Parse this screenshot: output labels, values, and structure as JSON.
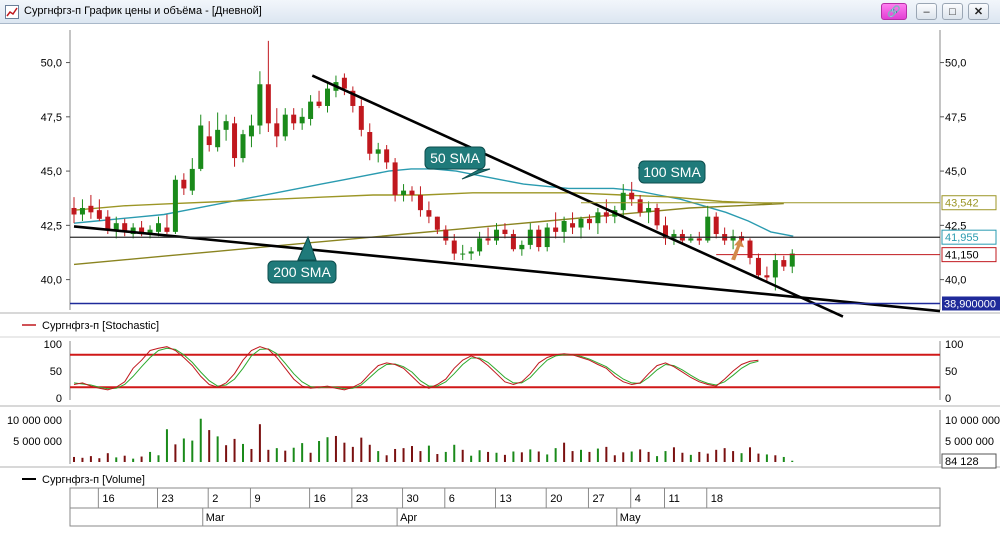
{
  "window": {
    "title": "Сургнфгз-п График цены и объёма - [Дневной]",
    "buttons": [
      "link",
      "minimize",
      "restore",
      "close"
    ]
  },
  "legend": {
    "stochastic": "Сургнфгз-п [Stochastic]",
    "volume": "Сургнфгз-п [Volume]"
  },
  "colors": {
    "up": "#1a8a1a",
    "down": "#c0181e",
    "sma50": "#2a9bb0",
    "sma100": "#9c9626",
    "sma200": "#8a8420",
    "callout": "#1f7a7a",
    "stoch_k": "#c0181e",
    "stoch_d": "#2eaa2e",
    "blue_line": "#1f2a9a"
  },
  "chart_data": {
    "type": "candlestick",
    "price_axis": {
      "ticks": [
        "50,0",
        "47,5",
        "45,0",
        "42,5",
        "40,0"
      ],
      "tick_values": [
        50,
        47.5,
        45,
        42.5,
        40
      ],
      "ylim": [
        38.6,
        51.5
      ]
    },
    "price_markers": [
      {
        "label": "43,542",
        "value": 43.542,
        "color": "#9c9626"
      },
      {
        "label": "41,955",
        "value": 41.955,
        "color": "#2a9bb0"
      },
      {
        "label": "41,150",
        "value": 41.15,
        "color": "#c0181e"
      },
      {
        "label": "38,900000",
        "value": 38.9,
        "color": "#1f2a9a"
      }
    ],
    "annotations": [
      {
        "text": "50 SMA"
      },
      {
        "text": "100 SMA"
      },
      {
        "text": "200 SMA"
      }
    ],
    "candles": [
      {
        "o": 43.3,
        "h": 43.8,
        "l": 42.6,
        "c": 43.0
      },
      {
        "o": 43.0,
        "h": 43.7,
        "l": 42.7,
        "c": 43.3
      },
      {
        "o": 43.4,
        "h": 43.9,
        "l": 42.8,
        "c": 43.1
      },
      {
        "o": 43.2,
        "h": 43.7,
        "l": 42.7,
        "c": 42.8
      },
      {
        "o": 42.9,
        "h": 43.2,
        "l": 42.1,
        "c": 42.3
      },
      {
        "o": 42.3,
        "h": 42.9,
        "l": 41.9,
        "c": 42.6
      },
      {
        "o": 42.6,
        "h": 42.8,
        "l": 42.0,
        "c": 42.2
      },
      {
        "o": 42.1,
        "h": 42.6,
        "l": 41.9,
        "c": 42.4
      },
      {
        "o": 42.4,
        "h": 42.7,
        "l": 42.0,
        "c": 42.1
      },
      {
        "o": 42.1,
        "h": 42.5,
        "l": 41.9,
        "c": 42.3
      },
      {
        "o": 42.2,
        "h": 42.9,
        "l": 42.0,
        "c": 42.6
      },
      {
        "o": 42.4,
        "h": 43.0,
        "l": 42.1,
        "c": 42.2
      },
      {
        "o": 42.2,
        "h": 44.8,
        "l": 42.1,
        "c": 44.6
      },
      {
        "o": 44.6,
        "h": 44.9,
        "l": 43.9,
        "c": 44.2
      },
      {
        "o": 44.1,
        "h": 45.6,
        "l": 43.9,
        "c": 45.1
      },
      {
        "o": 45.1,
        "h": 47.6,
        "l": 45.0,
        "c": 47.1
      },
      {
        "o": 46.6,
        "h": 47.3,
        "l": 45.9,
        "c": 46.2
      },
      {
        "o": 46.1,
        "h": 47.7,
        "l": 45.9,
        "c": 46.9
      },
      {
        "o": 46.9,
        "h": 47.6,
        "l": 46.4,
        "c": 47.3
      },
      {
        "o": 47.2,
        "h": 47.5,
        "l": 45.2,
        "c": 45.6
      },
      {
        "o": 45.6,
        "h": 46.9,
        "l": 45.4,
        "c": 46.7
      },
      {
        "o": 46.6,
        "h": 47.6,
        "l": 46.1,
        "c": 47.1
      },
      {
        "o": 47.1,
        "h": 49.6,
        "l": 46.7,
        "c": 49.0
      },
      {
        "o": 49.0,
        "h": 51.0,
        "l": 46.8,
        "c": 47.2
      },
      {
        "o": 47.2,
        "h": 47.9,
        "l": 46.1,
        "c": 46.6
      },
      {
        "o": 46.6,
        "h": 47.9,
        "l": 46.4,
        "c": 47.6
      },
      {
        "o": 47.6,
        "h": 47.9,
        "l": 46.9,
        "c": 47.2
      },
      {
        "o": 47.2,
        "h": 47.9,
        "l": 46.9,
        "c": 47.5
      },
      {
        "o": 47.4,
        "h": 48.5,
        "l": 47.1,
        "c": 48.2
      },
      {
        "o": 48.2,
        "h": 48.7,
        "l": 47.9,
        "c": 48.0
      },
      {
        "o": 48.0,
        "h": 49.1,
        "l": 47.7,
        "c": 48.8
      },
      {
        "o": 48.7,
        "h": 49.4,
        "l": 48.4,
        "c": 49.1
      },
      {
        "o": 49.3,
        "h": 49.5,
        "l": 48.5,
        "c": 48.8
      },
      {
        "o": 48.7,
        "h": 48.9,
        "l": 47.7,
        "c": 48.0
      },
      {
        "o": 48.0,
        "h": 48.3,
        "l": 46.6,
        "c": 46.9
      },
      {
        "o": 46.8,
        "h": 47.2,
        "l": 45.5,
        "c": 45.8
      },
      {
        "o": 45.8,
        "h": 46.3,
        "l": 45.4,
        "c": 46.0
      },
      {
        "o": 46.0,
        "h": 46.2,
        "l": 45.1,
        "c": 45.4
      },
      {
        "o": 45.4,
        "h": 45.6,
        "l": 43.6,
        "c": 43.9
      },
      {
        "o": 43.9,
        "h": 44.4,
        "l": 43.6,
        "c": 44.1
      },
      {
        "o": 44.1,
        "h": 44.3,
        "l": 43.6,
        "c": 43.9
      },
      {
        "o": 43.9,
        "h": 44.3,
        "l": 42.9,
        "c": 43.2
      },
      {
        "o": 43.2,
        "h": 43.6,
        "l": 42.6,
        "c": 42.9
      },
      {
        "o": 42.9,
        "h": 42.9,
        "l": 42.1,
        "c": 42.3
      },
      {
        "o": 42.3,
        "h": 42.5,
        "l": 41.6,
        "c": 41.8
      },
      {
        "o": 41.8,
        "h": 42.1,
        "l": 40.9,
        "c": 41.2
      },
      {
        "o": 41.2,
        "h": 41.6,
        "l": 40.9,
        "c": 41.2
      },
      {
        "o": 41.2,
        "h": 41.5,
        "l": 40.9,
        "c": 41.3
      },
      {
        "o": 41.3,
        "h": 42.2,
        "l": 41.1,
        "c": 41.9
      },
      {
        "o": 41.9,
        "h": 42.4,
        "l": 41.6,
        "c": 41.8
      },
      {
        "o": 41.8,
        "h": 42.6,
        "l": 41.6,
        "c": 42.3
      },
      {
        "o": 42.3,
        "h": 42.6,
        "l": 41.9,
        "c": 42.1
      },
      {
        "o": 42.1,
        "h": 42.3,
        "l": 41.3,
        "c": 41.4
      },
      {
        "o": 41.4,
        "h": 41.8,
        "l": 41.1,
        "c": 41.6
      },
      {
        "o": 41.6,
        "h": 42.6,
        "l": 41.4,
        "c": 42.3
      },
      {
        "o": 42.3,
        "h": 42.5,
        "l": 41.3,
        "c": 41.5
      },
      {
        "o": 41.5,
        "h": 42.6,
        "l": 41.3,
        "c": 42.4
      },
      {
        "o": 42.4,
        "h": 43.1,
        "l": 41.9,
        "c": 42.2
      },
      {
        "o": 42.2,
        "h": 42.9,
        "l": 41.7,
        "c": 42.7
      },
      {
        "o": 42.6,
        "h": 43.1,
        "l": 42.1,
        "c": 42.4
      },
      {
        "o": 42.4,
        "h": 42.9,
        "l": 41.9,
        "c": 42.8
      },
      {
        "o": 42.8,
        "h": 43.0,
        "l": 42.3,
        "c": 42.6
      },
      {
        "o": 42.6,
        "h": 43.3,
        "l": 42.1,
        "c": 43.1
      },
      {
        "o": 43.1,
        "h": 43.7,
        "l": 42.6,
        "c": 42.9
      },
      {
        "o": 42.9,
        "h": 43.4,
        "l": 42.6,
        "c": 43.2
      },
      {
        "o": 43.2,
        "h": 44.4,
        "l": 42.9,
        "c": 44.0
      },
      {
        "o": 44.0,
        "h": 44.5,
        "l": 43.4,
        "c": 43.7
      },
      {
        "o": 43.7,
        "h": 43.9,
        "l": 42.9,
        "c": 43.1
      },
      {
        "o": 43.1,
        "h": 43.6,
        "l": 42.6,
        "c": 43.3
      },
      {
        "o": 43.3,
        "h": 43.5,
        "l": 42.3,
        "c": 42.5
      },
      {
        "o": 42.5,
        "h": 42.9,
        "l": 41.6,
        "c": 41.9
      },
      {
        "o": 41.9,
        "h": 42.3,
        "l": 41.6,
        "c": 42.1
      },
      {
        "o": 42.1,
        "h": 42.3,
        "l": 41.6,
        "c": 41.8
      },
      {
        "o": 41.8,
        "h": 42.1,
        "l": 41.7,
        "c": 41.9
      },
      {
        "o": 41.9,
        "h": 42.2,
        "l": 41.6,
        "c": 41.8
      },
      {
        "o": 41.8,
        "h": 43.4,
        "l": 41.7,
        "c": 42.9
      },
      {
        "o": 42.9,
        "h": 43.1,
        "l": 41.9,
        "c": 42.1
      },
      {
        "o": 42.1,
        "h": 42.4,
        "l": 41.6,
        "c": 41.8
      },
      {
        "o": 41.8,
        "h": 42.3,
        "l": 41.4,
        "c": 42.0
      },
      {
        "o": 42.0,
        "h": 42.2,
        "l": 41.6,
        "c": 41.8
      },
      {
        "o": 41.8,
        "h": 41.9,
        "l": 40.7,
        "c": 41.0
      },
      {
        "o": 41.0,
        "h": 41.2,
        "l": 40.1,
        "c": 40.2
      },
      {
        "o": 40.2,
        "h": 40.6,
        "l": 39.9,
        "c": 40.1
      },
      {
        "o": 40.1,
        "h": 41.2,
        "l": 39.5,
        "c": 40.9
      },
      {
        "o": 40.9,
        "h": 41.1,
        "l": 40.4,
        "c": 40.6
      },
      {
        "o": 40.6,
        "h": 41.4,
        "l": 40.3,
        "c": 41.2
      }
    ],
    "sma50": [
      42.6,
      42.7,
      42.8,
      42.9,
      43.0,
      43.2,
      43.4,
      43.6,
      43.8,
      44.0,
      44.2,
      44.4,
      44.6,
      44.8,
      45.0,
      45.1,
      45.1,
      45.0,
      44.8,
      44.6,
      44.4,
      44.3,
      44.2,
      44.2,
      44.2,
      44.1,
      43.9,
      43.7,
      43.4,
      43.1,
      42.7,
      42.2,
      42.0
    ],
    "sma100": [
      43.2,
      43.4,
      43.5,
      43.6,
      43.7,
      43.8,
      43.9,
      43.9,
      44.0,
      44.0,
      44.0,
      43.9,
      43.8,
      43.6,
      43.5
    ],
    "sma200": [
      40.7,
      40.9,
      41.1,
      41.3,
      41.5,
      41.7,
      41.9,
      42.1,
      42.3,
      42.5,
      42.7,
      42.9,
      43.1,
      43.3,
      43.4,
      43.5
    ],
    "stochastic": {
      "ticks": [
        "100",
        "50",
        "0"
      ],
      "tick_values": [
        100,
        50,
        0
      ],
      "levels": [
        80,
        20
      ],
      "k": [
        25,
        28,
        22,
        18,
        15,
        20,
        30,
        55,
        70,
        88,
        92,
        95,
        88,
        75,
        60,
        40,
        25,
        20,
        28,
        45,
        70,
        88,
        95,
        90,
        75,
        55,
        35,
        22,
        18,
        20,
        22,
        18,
        15,
        20,
        28,
        45,
        60,
        65,
        62,
        55,
        40,
        25,
        18,
        25,
        35,
        55,
        70,
        78,
        72,
        60,
        45,
        30,
        25,
        30,
        45,
        65,
        75,
        80,
        82,
        80,
        75,
        70,
        62,
        55,
        40,
        30,
        25,
        28,
        45,
        60,
        65,
        58,
        48,
        38,
        30,
        25,
        22,
        35,
        50,
        62,
        68,
        70
      ],
      "d": [
        28,
        26,
        24,
        20,
        17,
        18,
        25,
        40,
        58,
        75,
        88,
        92,
        90,
        80,
        66,
        48,
        32,
        22,
        24,
        35,
        55,
        78,
        90,
        91,
        82,
        64,
        45,
        30,
        21,
        19,
        21,
        20,
        17,
        18,
        24,
        38,
        52,
        62,
        63,
        58,
        48,
        32,
        22,
        22,
        30,
        45,
        62,
        74,
        74,
        66,
        52,
        38,
        28,
        28,
        38,
        55,
        70,
        78,
        80,
        80,
        77,
        72,
        65,
        58,
        46,
        35,
        28,
        27,
        38,
        52,
        62,
        60,
        52,
        42,
        33,
        27,
        24,
        30,
        42,
        55,
        64,
        68
      ]
    },
    "volume": {
      "ticks": [
        "10 000 000",
        "5 000 000"
      ],
      "tick_values": [
        10000000,
        5000000
      ],
      "last_label": "84 128",
      "bars": [
        {
          "v": 1.2,
          "c": "d"
        },
        {
          "v": 1.0,
          "c": "d"
        },
        {
          "v": 1.4,
          "c": "d"
        },
        {
          "v": 0.9,
          "c": "d"
        },
        {
          "v": 2.1,
          "c": "d"
        },
        {
          "v": 1.1,
          "c": "u"
        },
        {
          "v": 1.5,
          "c": "d"
        },
        {
          "v": 0.8,
          "c": "u"
        },
        {
          "v": 1.3,
          "c": "d"
        },
        {
          "v": 2.4,
          "c": "u"
        },
        {
          "v": 1.6,
          "c": "u"
        },
        {
          "v": 7.8,
          "c": "u"
        },
        {
          "v": 4.2,
          "c": "d"
        },
        {
          "v": 5.6,
          "c": "u"
        },
        {
          "v": 5.1,
          "c": "u"
        },
        {
          "v": 10.3,
          "c": "u"
        },
        {
          "v": 7.6,
          "c": "d"
        },
        {
          "v": 6.1,
          "c": "u"
        },
        {
          "v": 4.0,
          "c": "d"
        },
        {
          "v": 5.5,
          "c": "d"
        },
        {
          "v": 4.3,
          "c": "u"
        },
        {
          "v": 3.1,
          "c": "d"
        },
        {
          "v": 9.0,
          "c": "d"
        },
        {
          "v": 2.9,
          "c": "d"
        },
        {
          "v": 3.3,
          "c": "u"
        },
        {
          "v": 2.7,
          "c": "d"
        },
        {
          "v": 3.4,
          "c": "u"
        },
        {
          "v": 4.5,
          "c": "u"
        },
        {
          "v": 2.2,
          "c": "d"
        },
        {
          "v": 5.0,
          "c": "u"
        },
        {
          "v": 5.9,
          "c": "u"
        },
        {
          "v": 6.2,
          "c": "d"
        },
        {
          "v": 4.6,
          "c": "d"
        },
        {
          "v": 3.6,
          "c": "d"
        },
        {
          "v": 5.8,
          "c": "d"
        },
        {
          "v": 4.1,
          "c": "d"
        },
        {
          "v": 2.6,
          "c": "u"
        },
        {
          "v": 1.6,
          "c": "d"
        },
        {
          "v": 3.1,
          "c": "d"
        },
        {
          "v": 3.3,
          "c": "d"
        },
        {
          "v": 3.8,
          "c": "d"
        },
        {
          "v": 2.6,
          "c": "d"
        },
        {
          "v": 3.9,
          "c": "u"
        },
        {
          "v": 1.9,
          "c": "d"
        },
        {
          "v": 2.4,
          "c": "u"
        },
        {
          "v": 4.1,
          "c": "u"
        },
        {
          "v": 2.9,
          "c": "d"
        },
        {
          "v": 1.5,
          "c": "u"
        },
        {
          "v": 2.8,
          "c": "u"
        },
        {
          "v": 2.4,
          "c": "d"
        },
        {
          "v": 2.2,
          "c": "u"
        },
        {
          "v": 1.7,
          "c": "d"
        },
        {
          "v": 2.5,
          "c": "u"
        },
        {
          "v": 2.3,
          "c": "d"
        },
        {
          "v": 3.0,
          "c": "u"
        },
        {
          "v": 2.5,
          "c": "d"
        },
        {
          "v": 1.8,
          "c": "u"
        },
        {
          "v": 3.3,
          "c": "u"
        },
        {
          "v": 4.6,
          "c": "d"
        },
        {
          "v": 2.6,
          "c": "d"
        },
        {
          "v": 2.9,
          "c": "u"
        },
        {
          "v": 2.4,
          "c": "d"
        },
        {
          "v": 3.2,
          "c": "u"
        },
        {
          "v": 3.6,
          "c": "d"
        },
        {
          "v": 1.6,
          "c": "d"
        },
        {
          "v": 2.3,
          "c": "d"
        },
        {
          "v": 2.5,
          "c": "u"
        },
        {
          "v": 3.0,
          "c": "d"
        },
        {
          "v": 2.4,
          "c": "d"
        },
        {
          "v": 1.4,
          "c": "u"
        },
        {
          "v": 2.6,
          "c": "u"
        },
        {
          "v": 3.5,
          "c": "d"
        },
        {
          "v": 2.2,
          "c": "d"
        },
        {
          "v": 1.7,
          "c": "u"
        },
        {
          "v": 2.4,
          "c": "d"
        },
        {
          "v": 2.0,
          "c": "d"
        },
        {
          "v": 2.9,
          "c": "d"
        },
        {
          "v": 3.3,
          "c": "d"
        },
        {
          "v": 2.6,
          "c": "d"
        },
        {
          "v": 2.1,
          "c": "u"
        },
        {
          "v": 3.5,
          "c": "d"
        },
        {
          "v": 2.0,
          "c": "d"
        },
        {
          "v": 1.8,
          "c": "u"
        },
        {
          "v": 1.6,
          "c": "d"
        },
        {
          "v": 1.2,
          "c": "u"
        },
        {
          "v": 0.3,
          "c": "u"
        }
      ]
    },
    "x_axis": {
      "day_ticks": [
        {
          "label": "16",
          "i": 3
        },
        {
          "label": "23",
          "i": 10
        },
        {
          "label": "2",
          "i": 16
        },
        {
          "label": "9",
          "i": 21
        },
        {
          "label": "16",
          "i": 28
        },
        {
          "label": "23",
          "i": 33
        },
        {
          "label": "30",
          "i": 39
        },
        {
          "label": "6",
          "i": 44
        },
        {
          "label": "13",
          "i": 50
        },
        {
          "label": "20",
          "i": 56
        },
        {
          "label": "27",
          "i": 61
        },
        {
          "label": "4",
          "i": 66
        },
        {
          "label": "11",
          "i": 70
        },
        {
          "label": "18",
          "i": 75
        }
      ],
      "month_ticks": [
        {
          "label": "Mar",
          "i": 15
        },
        {
          "label": "Apr",
          "i": 38
        },
        {
          "label": "May",
          "i": 64
        }
      ]
    }
  }
}
